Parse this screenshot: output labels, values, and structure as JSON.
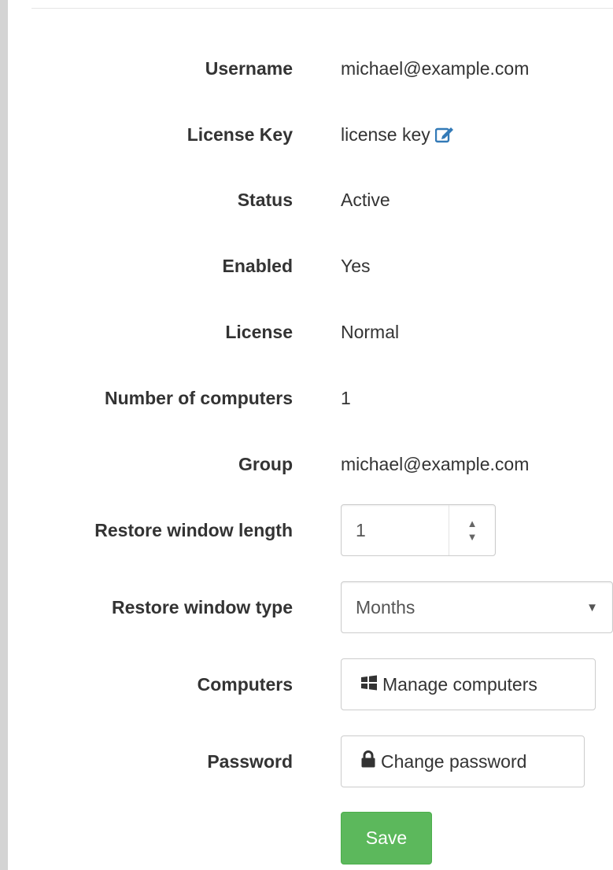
{
  "fields": {
    "username": {
      "label": "Username",
      "value": "michael@example.com"
    },
    "license_key": {
      "label": "License Key",
      "value": "license key"
    },
    "status": {
      "label": "Status",
      "value": "Active"
    },
    "enabled": {
      "label": "Enabled",
      "value": "Yes"
    },
    "license": {
      "label": "License",
      "value": "Normal"
    },
    "num_computers": {
      "label": "Number of computers",
      "value": "1"
    },
    "group": {
      "label": "Group",
      "value": "michael@example.com"
    },
    "restore_length": {
      "label": "Restore window length",
      "value": "1"
    },
    "restore_type": {
      "label": "Restore window type",
      "selected": "Months"
    },
    "computers": {
      "label": "Computers",
      "button": "Manage computers"
    },
    "password": {
      "label": "Password",
      "button": "Change password"
    }
  },
  "actions": {
    "save_label": "Save"
  },
  "icons": {
    "license_key_edit": "edit-icon",
    "manage_computers": "windows-icon",
    "change_password": "lock-icon",
    "stepper_up": "chevron-up-icon",
    "stepper_down": "chevron-down-icon",
    "select_caret": "caret-down-icon"
  },
  "colors": {
    "link_blue": "#337ab7",
    "save_green": "#5cb85c",
    "text": "#333333",
    "border": "#cccccc"
  }
}
